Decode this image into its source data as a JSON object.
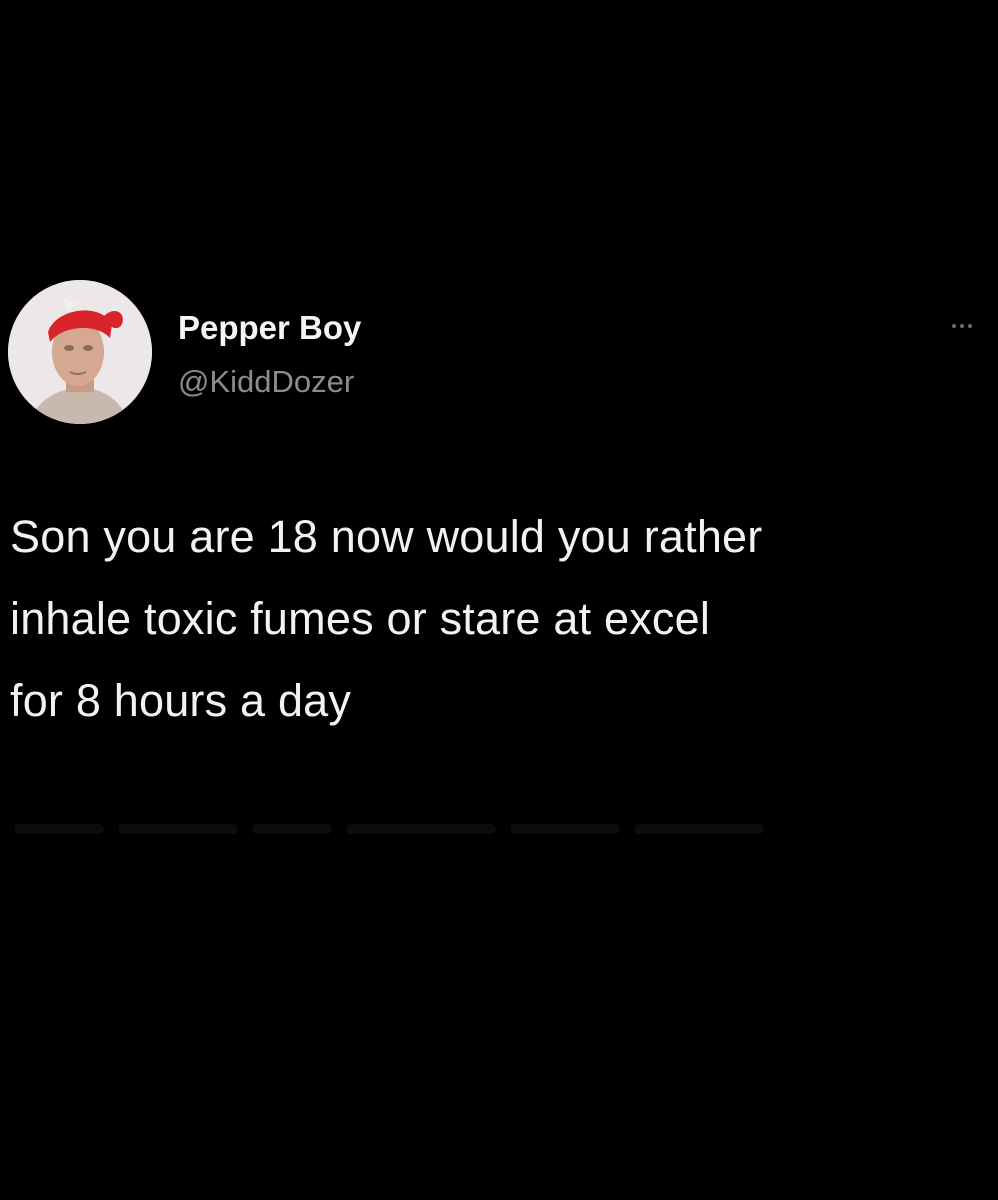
{
  "tweet": {
    "author": {
      "display_name": "Pepper Boy",
      "handle": "@KiddDozer",
      "avatar_icon": "profile-avatar"
    },
    "more_icon": "more-options-icon",
    "text_lines": [
      "Son you are 18 now would you rather",
      "inhale toxic fumes or stare at excel",
      "for 8 hours a day"
    ]
  },
  "colors": {
    "background": "#000000",
    "text": "#f2f2f2",
    "secondary_text": "#8c8c8c",
    "avatar_headband": "#d8252a"
  }
}
